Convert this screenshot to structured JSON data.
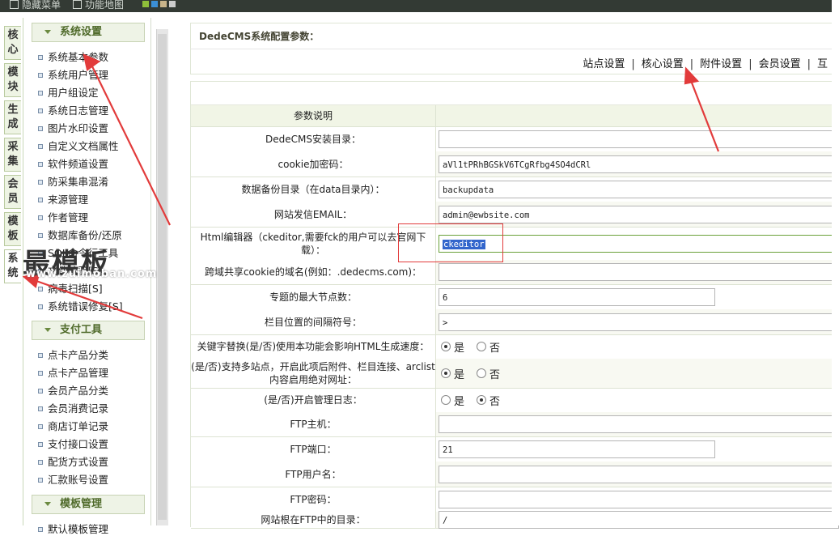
{
  "topbar": {
    "hide_menu": "隐藏菜单",
    "site_map": "功能地图",
    "theme_colors": [
      "#8fbf3a",
      "#3b8fd6",
      "#c8b48a",
      "#cccccc"
    ]
  },
  "left_tabs": [
    "核心",
    "模块",
    "生成",
    "采集",
    "会员",
    "模板",
    "系统"
  ],
  "menu": {
    "groups": [
      {
        "title": "系统设置",
        "items": [
          "系统基本参数",
          "系统用户管理",
          "用户组设定",
          "系统日志管理",
          "图片水印设置",
          "自定义文档属性",
          "软件频道设置",
          "防采集串混淆",
          "来源管理",
          "作者管理",
          "数据库备份/还原",
          "SQL命令行工具",
          "文件校验[S]",
          "病毒扫描[S]",
          "系统错误修复[S]"
        ]
      },
      {
        "title": "支付工具",
        "items": [
          "点卡产品分类",
          "点卡产品管理",
          "会员产品分类",
          "会员消费记录",
          "商店订单记录",
          "支付接口设置",
          "配货方式设置",
          "汇款账号设置"
        ]
      },
      {
        "title": "模板管理",
        "items": [
          "默认模板管理"
        ]
      }
    ]
  },
  "panel": {
    "title": "DedeCMS系统配置参数：",
    "links": [
      "站点设置",
      "核心设置",
      "附件设置",
      "会员设置",
      "互"
    ]
  },
  "table": {
    "header": "参数说明",
    "rows": [
      {
        "label": "DedeCMS安装目录：",
        "type": "text",
        "value": ""
      },
      {
        "label": "cookie加密码：",
        "type": "text",
        "value": "aVl1tPRhBGSkV6TCgRfbg4SO4dCRl"
      },
      {
        "label": "数据备份目录（在data目录内）：",
        "type": "text",
        "value": "backupdata"
      },
      {
        "label": "网站发信EMAIL：",
        "type": "text",
        "value": "admin@ewbsite.com"
      },
      {
        "label": "Html编辑器（ckeditor,需要fck的用户可以去官网下载）：",
        "type": "text",
        "value": "ckeditor",
        "focused": true
      },
      {
        "label": "跨域共享cookie的域名(例如：.dedecms.com)：",
        "type": "text",
        "value": ""
      },
      {
        "label": "专题的最大节点数：",
        "type": "short",
        "value": "6"
      },
      {
        "label": "栏目位置的间隔符号：",
        "type": "text",
        "value": ">"
      },
      {
        "label": "关键字替换(是/否)使用本功能会影响HTML生成速度：",
        "type": "radio",
        "yes": "是",
        "no": "否",
        "selected": "yes"
      },
      {
        "label": "(是/否)支持多站点，开启此项后附件、栏目连接、arclist内容启用绝对网址：",
        "type": "radio",
        "yes": "是",
        "no": "否",
        "selected": "yes"
      },
      {
        "label": "(是/否)开启管理日志：",
        "type": "radio",
        "yes": "是",
        "no": "否",
        "selected": "no"
      },
      {
        "label": "FTP主机：",
        "type": "text",
        "value": ""
      },
      {
        "label": "FTP端口：",
        "type": "short",
        "value": "21"
      },
      {
        "label": "FTP用户名：",
        "type": "text",
        "value": ""
      },
      {
        "label": "FTP密码：",
        "type": "text",
        "value": ""
      },
      {
        "label": "网站根在FTP中的目录：",
        "type": "text",
        "value": "/"
      }
    ]
  },
  "watermark": {
    "text": "最模板",
    "url": "www.zuimoban.com"
  },
  "annotation_color": "#e23b3b"
}
